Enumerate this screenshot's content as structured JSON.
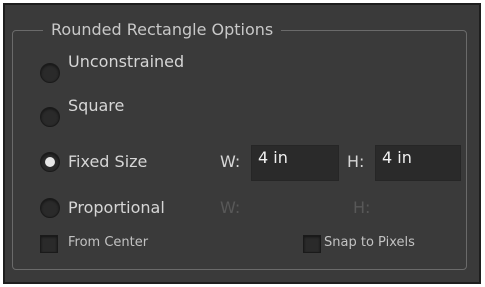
{
  "dialog": {
    "title": "Rounded Rectangle Options"
  },
  "options": {
    "unconstrained": "Unconstrained",
    "square": "Square",
    "fixed_size": "Fixed Size",
    "proportional": "Proportional",
    "selected": "fixed_size"
  },
  "fixed_size": {
    "w_label": "W:",
    "w_value": "4 in",
    "h_label": "H:",
    "h_value": "4 in"
  },
  "proportional": {
    "w_label": "W:",
    "h_label": "H:"
  },
  "checkboxes": {
    "from_center": "From Center",
    "snap_to_pixels": "Snap to Pixels"
  }
}
